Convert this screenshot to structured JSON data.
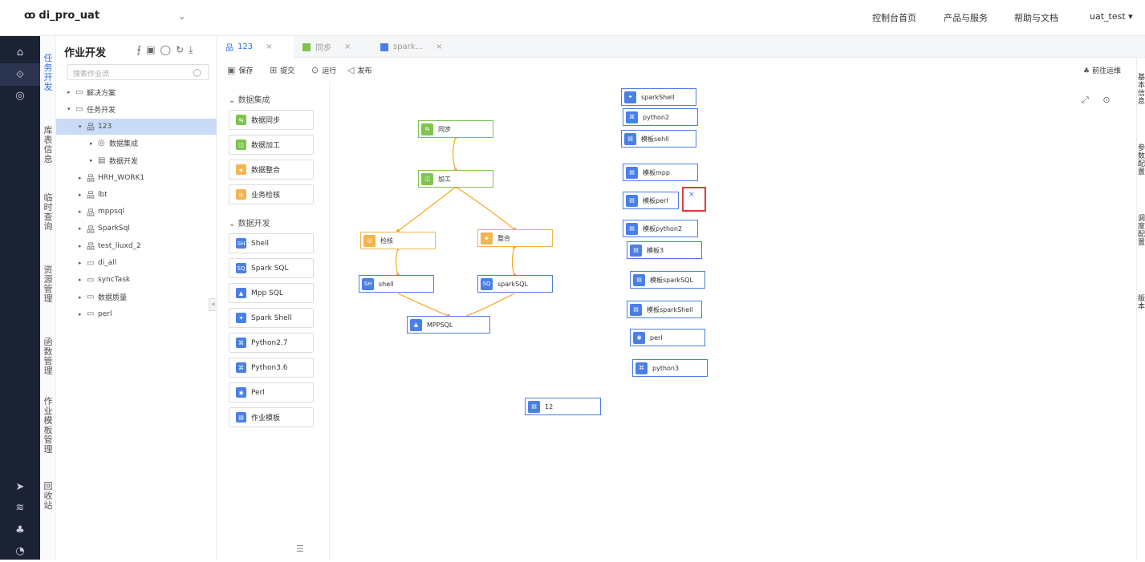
{
  "header": {
    "project": "di_pro_uat",
    "nav": [
      "控制台首页",
      "产品与服务",
      "帮助与文档"
    ],
    "user": "uat_test"
  },
  "vertical_nav": [
    "任务开发",
    "库表信息",
    "临时查询",
    "资源管理",
    "函数管理",
    "作业模板管理",
    "回收站"
  ],
  "tree": {
    "title": "作业开发",
    "search_placeholder": "搜索作业流",
    "nodes": [
      {
        "label": "解决方案",
        "caret": "▸",
        "icon": "folder",
        "indent": 0
      },
      {
        "label": "任务开发",
        "caret": "▾",
        "icon": "folder",
        "indent": 0
      },
      {
        "label": "123",
        "caret": "▾",
        "icon": "flow",
        "indent": 1,
        "selected": true
      },
      {
        "label": "数据集成",
        "caret": "▸",
        "icon": "integration",
        "indent": 2
      },
      {
        "label": "数据开发",
        "caret": "▸",
        "icon": "dev",
        "indent": 2
      },
      {
        "label": "HRH_WORK1",
        "caret": "▸",
        "icon": "flow",
        "indent": 1
      },
      {
        "label": "lbt",
        "caret": "▸",
        "icon": "flow",
        "indent": 1
      },
      {
        "label": "mppsql",
        "caret": "▸",
        "icon": "flow",
        "indent": 1
      },
      {
        "label": "SparkSql",
        "caret": "▸",
        "icon": "flow",
        "indent": 1
      },
      {
        "label": "test_liuxd_2",
        "caret": "▸",
        "icon": "flow",
        "indent": 1
      },
      {
        "label": "di_all",
        "caret": "▸",
        "icon": "folder",
        "indent": 1
      },
      {
        "label": "syncTask",
        "caret": "▸",
        "icon": "folder",
        "indent": 1
      },
      {
        "label": "数据质量",
        "caret": "▸",
        "icon": "folder",
        "indent": 1
      },
      {
        "label": "perl",
        "caret": "▸",
        "icon": "folder",
        "indent": 1
      }
    ]
  },
  "tabs": [
    {
      "label": "123",
      "active": true,
      "color": "#2e6ff0"
    },
    {
      "label": "同步",
      "active": false,
      "color": "#7ec44f"
    },
    {
      "label": "spark...",
      "active": false,
      "color": "#4a7fe6"
    }
  ],
  "toolbar": {
    "save": "保存",
    "submit": "提交",
    "run": "运行",
    "publish": "发布",
    "ops": "前往运维"
  },
  "palette": {
    "section1": "数据集成",
    "section2": "数据开发",
    "group1": [
      {
        "label": "数据同步",
        "color": "#7ec44f",
        "glyph": "⇆"
      },
      {
        "label": "数据加工",
        "color": "#7ec44f",
        "glyph": "◫"
      },
      {
        "label": "数据整合",
        "color": "#f4b44e",
        "glyph": "◈"
      },
      {
        "label": "业务检核",
        "color": "#f4b44e",
        "glyph": "◎"
      }
    ],
    "group2": [
      {
        "label": "Shell",
        "color": "#4a7fe6",
        "glyph": "SH"
      },
      {
        "label": "Spark SQL",
        "color": "#4a7fe6",
        "glyph": "SQ"
      },
      {
        "label": "Mpp SQL",
        "color": "#4a7fe6",
        "glyph": "▲"
      },
      {
        "label": "Spark Shell",
        "color": "#4a7fe6",
        "glyph": "✦"
      },
      {
        "label": "Python2.7",
        "color": "#4a7fe6",
        "glyph": "⌘"
      },
      {
        "label": "Python3.6",
        "color": "#4a7fe6",
        "glyph": "⌘"
      },
      {
        "label": "Perl",
        "color": "#4a7fe6",
        "glyph": "◉"
      },
      {
        "label": "作业模板",
        "color": "#4a7fe6",
        "glyph": "▤"
      }
    ]
  },
  "canvas": {
    "flow_nodes": [
      {
        "label": "同步",
        "type": "green",
        "glyph": "⇆"
      },
      {
        "label": "加工",
        "type": "green",
        "glyph": "◫"
      },
      {
        "label": "检核",
        "type": "orange",
        "glyph": "◎"
      },
      {
        "label": "整合",
        "type": "orange",
        "glyph": "◈"
      },
      {
        "label": "shell",
        "type": "blue",
        "glyph": "SH"
      },
      {
        "label": "sparkSQL",
        "type": "blue",
        "glyph": "SQ"
      },
      {
        "label": "MPPSQL",
        "type": "blue",
        "glyph": "▲"
      }
    ],
    "side_nodes": [
      {
        "label": "sparkShell",
        "glyph": "✦"
      },
      {
        "label": "python2",
        "glyph": "⌘"
      },
      {
        "label": "模板sehll",
        "glyph": "▤"
      },
      {
        "label": "模板mpp",
        "glyph": "▤"
      },
      {
        "label": "模板perl",
        "glyph": "▤"
      },
      {
        "label": "模板python2",
        "glyph": "▤"
      },
      {
        "label": "模板3",
        "glyph": "▤"
      },
      {
        "label": "模板sparkSQL",
        "glyph": "▤"
      },
      {
        "label": "模板sparkShell",
        "glyph": "▤"
      },
      {
        "label": "perl",
        "glyph": "◉"
      },
      {
        "label": "python3",
        "glyph": "⌘"
      },
      {
        "label": "12",
        "glyph": "▤"
      }
    ]
  },
  "right_side": [
    "基本信息",
    "参数配置",
    "调度配置",
    "版本"
  ],
  "colors": {
    "accent": "#2e6ff0",
    "green": "#7ec44f",
    "orange": "#f4b44e",
    "blue": "#4a7fe6",
    "edge": "#f5a623",
    "highlight": "#e53935"
  }
}
